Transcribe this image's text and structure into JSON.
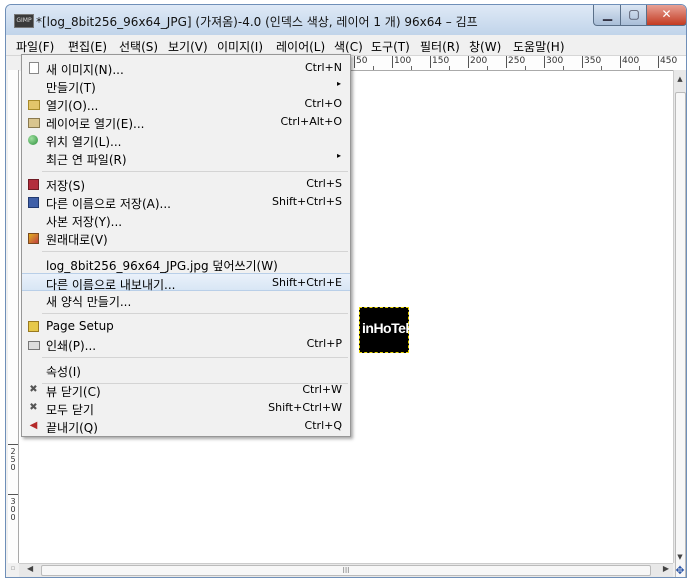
{
  "window": {
    "app_icon": "gimp-app-icon",
    "title": "*[log_8bit256_96x64_JPG] (가져옴)-4.0 (인덱스 색상, 레이어 1 개) 96x64 – 김프",
    "minimize_glyph": "▁",
    "maximize_glyph": "▢",
    "close_glyph": "✕"
  },
  "menubar": [
    {
      "label": "파일(F)"
    },
    {
      "label": "편집(E)"
    },
    {
      "label": "선택(S)"
    },
    {
      "label": "보기(V)"
    },
    {
      "label": "이미지(I)"
    },
    {
      "label": "레이어(L)"
    },
    {
      "label": "색(C)"
    },
    {
      "label": "도구(T)"
    },
    {
      "label": "필터(R)"
    },
    {
      "label": "창(W)"
    },
    {
      "label": "도움말(H)"
    }
  ],
  "file_menu": [
    {
      "icon": "new-document-icon",
      "label": "새 이미지(N)...",
      "shortcut": "Ctrl+N"
    },
    {
      "icon": "",
      "label": "만들기(T)",
      "submenu": "▸"
    },
    {
      "icon": "folder-open-icon",
      "label": "열기(O)...",
      "shortcut": "Ctrl+O"
    },
    {
      "icon": "open-as-layers-icon",
      "label": "레이어로 열기(E)...",
      "shortcut": "Ctrl+Alt+O"
    },
    {
      "icon": "globe-icon",
      "label": "위치 열기(L)..."
    },
    {
      "icon": "",
      "label": "최근 연 파일(R)",
      "submenu": "▸"
    },
    {
      "icon": "save-icon",
      "label": "저장(S)",
      "shortcut": "Ctrl+S"
    },
    {
      "icon": "save-as-icon",
      "label": "다른 이름으로 저장(A)...",
      "shortcut": "Shift+Ctrl+S"
    },
    {
      "icon": "",
      "label": "사본 저장(Y)..."
    },
    {
      "icon": "revert-icon",
      "label": "원래대로(V)"
    },
    {
      "icon": "",
      "label": "log_8bit256_96x64_JPG.jpg 덮어쓰기(W)"
    },
    {
      "icon": "",
      "label": "다른 이름으로 내보내기...",
      "shortcut": "Shift+Ctrl+E",
      "highlighted": true
    },
    {
      "icon": "",
      "label": "새 양식 만들기..."
    },
    {
      "icon": "page-setup-icon",
      "label": "Page Setup"
    },
    {
      "icon": "printer-icon",
      "label": "인쇄(P)...",
      "shortcut": "Ctrl+P"
    },
    {
      "icon": "",
      "label": "속성(I)"
    },
    {
      "icon": "close-view-icon",
      "label": "뷰 닫기(C)",
      "shortcut": "Ctrl+W"
    },
    {
      "icon": "close-all-icon",
      "label": "모두 닫기",
      "shortcut": "Shift+Ctrl+W"
    },
    {
      "icon": "quit-icon",
      "label": "끝내기(Q)",
      "shortcut": "Ctrl+Q"
    }
  ],
  "ruler_top": [
    "50",
    "100",
    "150",
    "200",
    "250",
    "300",
    "350",
    "400",
    "450"
  ],
  "ruler_left": [
    "250",
    "300"
  ],
  "canvas_image": {
    "text": "inHoTek"
  },
  "status": {
    "hscroll_grip": "III",
    "nav_icon": "✥"
  }
}
